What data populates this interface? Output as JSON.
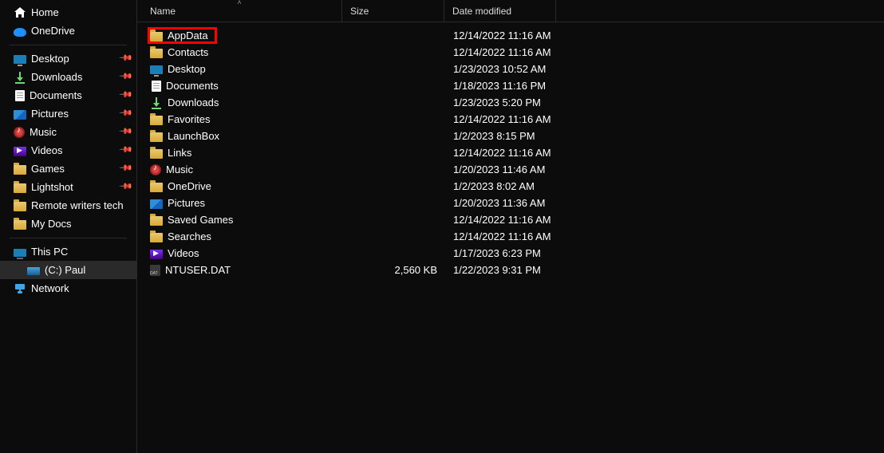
{
  "columns": {
    "name": "Name",
    "size": "Size",
    "date": "Date modified"
  },
  "sidebar": {
    "top": [
      {
        "label": "Home",
        "icon": "home"
      },
      {
        "label": "OneDrive",
        "icon": "onedrive"
      }
    ],
    "quick": [
      {
        "label": "Desktop",
        "icon": "desktop",
        "pinned": true
      },
      {
        "label": "Downloads",
        "icon": "downloads",
        "pinned": true
      },
      {
        "label": "Documents",
        "icon": "documents",
        "pinned": true
      },
      {
        "label": "Pictures",
        "icon": "pictures",
        "pinned": true
      },
      {
        "label": "Music",
        "icon": "music-p",
        "pinned": true
      },
      {
        "label": "Videos",
        "icon": "videos-p",
        "pinned": true
      },
      {
        "label": "Games",
        "icon": "folder",
        "pinned": true
      },
      {
        "label": "Lightshot",
        "icon": "folder",
        "pinned": true
      },
      {
        "label": "Remote writers tech",
        "icon": "folder",
        "pinned": false
      },
      {
        "label": "My Docs",
        "icon": "folder",
        "pinned": false
      }
    ],
    "computer": [
      {
        "label": "This PC",
        "icon": "thispc",
        "indent": false
      },
      {
        "label": "(C:) Paul",
        "icon": "drive",
        "indent": true,
        "selected": true
      },
      {
        "label": "Network",
        "icon": "network",
        "indent": false
      }
    ]
  },
  "files": [
    {
      "name": "AppData",
      "icon": "folder",
      "size": "",
      "date": "12/14/2022 11:16 AM",
      "highlight": true
    },
    {
      "name": "Contacts",
      "icon": "folder",
      "size": "",
      "date": "12/14/2022 11:16 AM"
    },
    {
      "name": "Desktop",
      "icon": "desktop",
      "size": "",
      "date": "1/23/2023 10:52 AM"
    },
    {
      "name": "Documents",
      "icon": "documents",
      "size": "",
      "date": "1/18/2023 11:16 PM"
    },
    {
      "name": "Downloads",
      "icon": "downloads",
      "size": "",
      "date": "1/23/2023 5:20 PM"
    },
    {
      "name": "Favorites",
      "icon": "folder",
      "size": "",
      "date": "12/14/2022 11:16 AM"
    },
    {
      "name": "LaunchBox",
      "icon": "folder",
      "size": "",
      "date": "1/2/2023 8:15 PM"
    },
    {
      "name": "Links",
      "icon": "folder",
      "size": "",
      "date": "12/14/2022 11:16 AM"
    },
    {
      "name": "Music",
      "icon": "music-p",
      "size": "",
      "date": "1/20/2023 11:46 AM"
    },
    {
      "name": "OneDrive",
      "icon": "folder",
      "size": "",
      "date": "1/2/2023 8:02 AM"
    },
    {
      "name": "Pictures",
      "icon": "pictures",
      "size": "",
      "date": "1/20/2023 11:36 AM"
    },
    {
      "name": "Saved Games",
      "icon": "folder",
      "size": "",
      "date": "12/14/2022 11:16 AM"
    },
    {
      "name": "Searches",
      "icon": "folder",
      "size": "",
      "date": "12/14/2022 11:16 AM"
    },
    {
      "name": "Videos",
      "icon": "videos-p",
      "size": "",
      "date": "1/17/2023 6:23 PM"
    },
    {
      "name": "NTUSER.DAT",
      "icon": "dat",
      "size": "2,560 KB",
      "date": "1/22/2023 9:31 PM"
    }
  ]
}
